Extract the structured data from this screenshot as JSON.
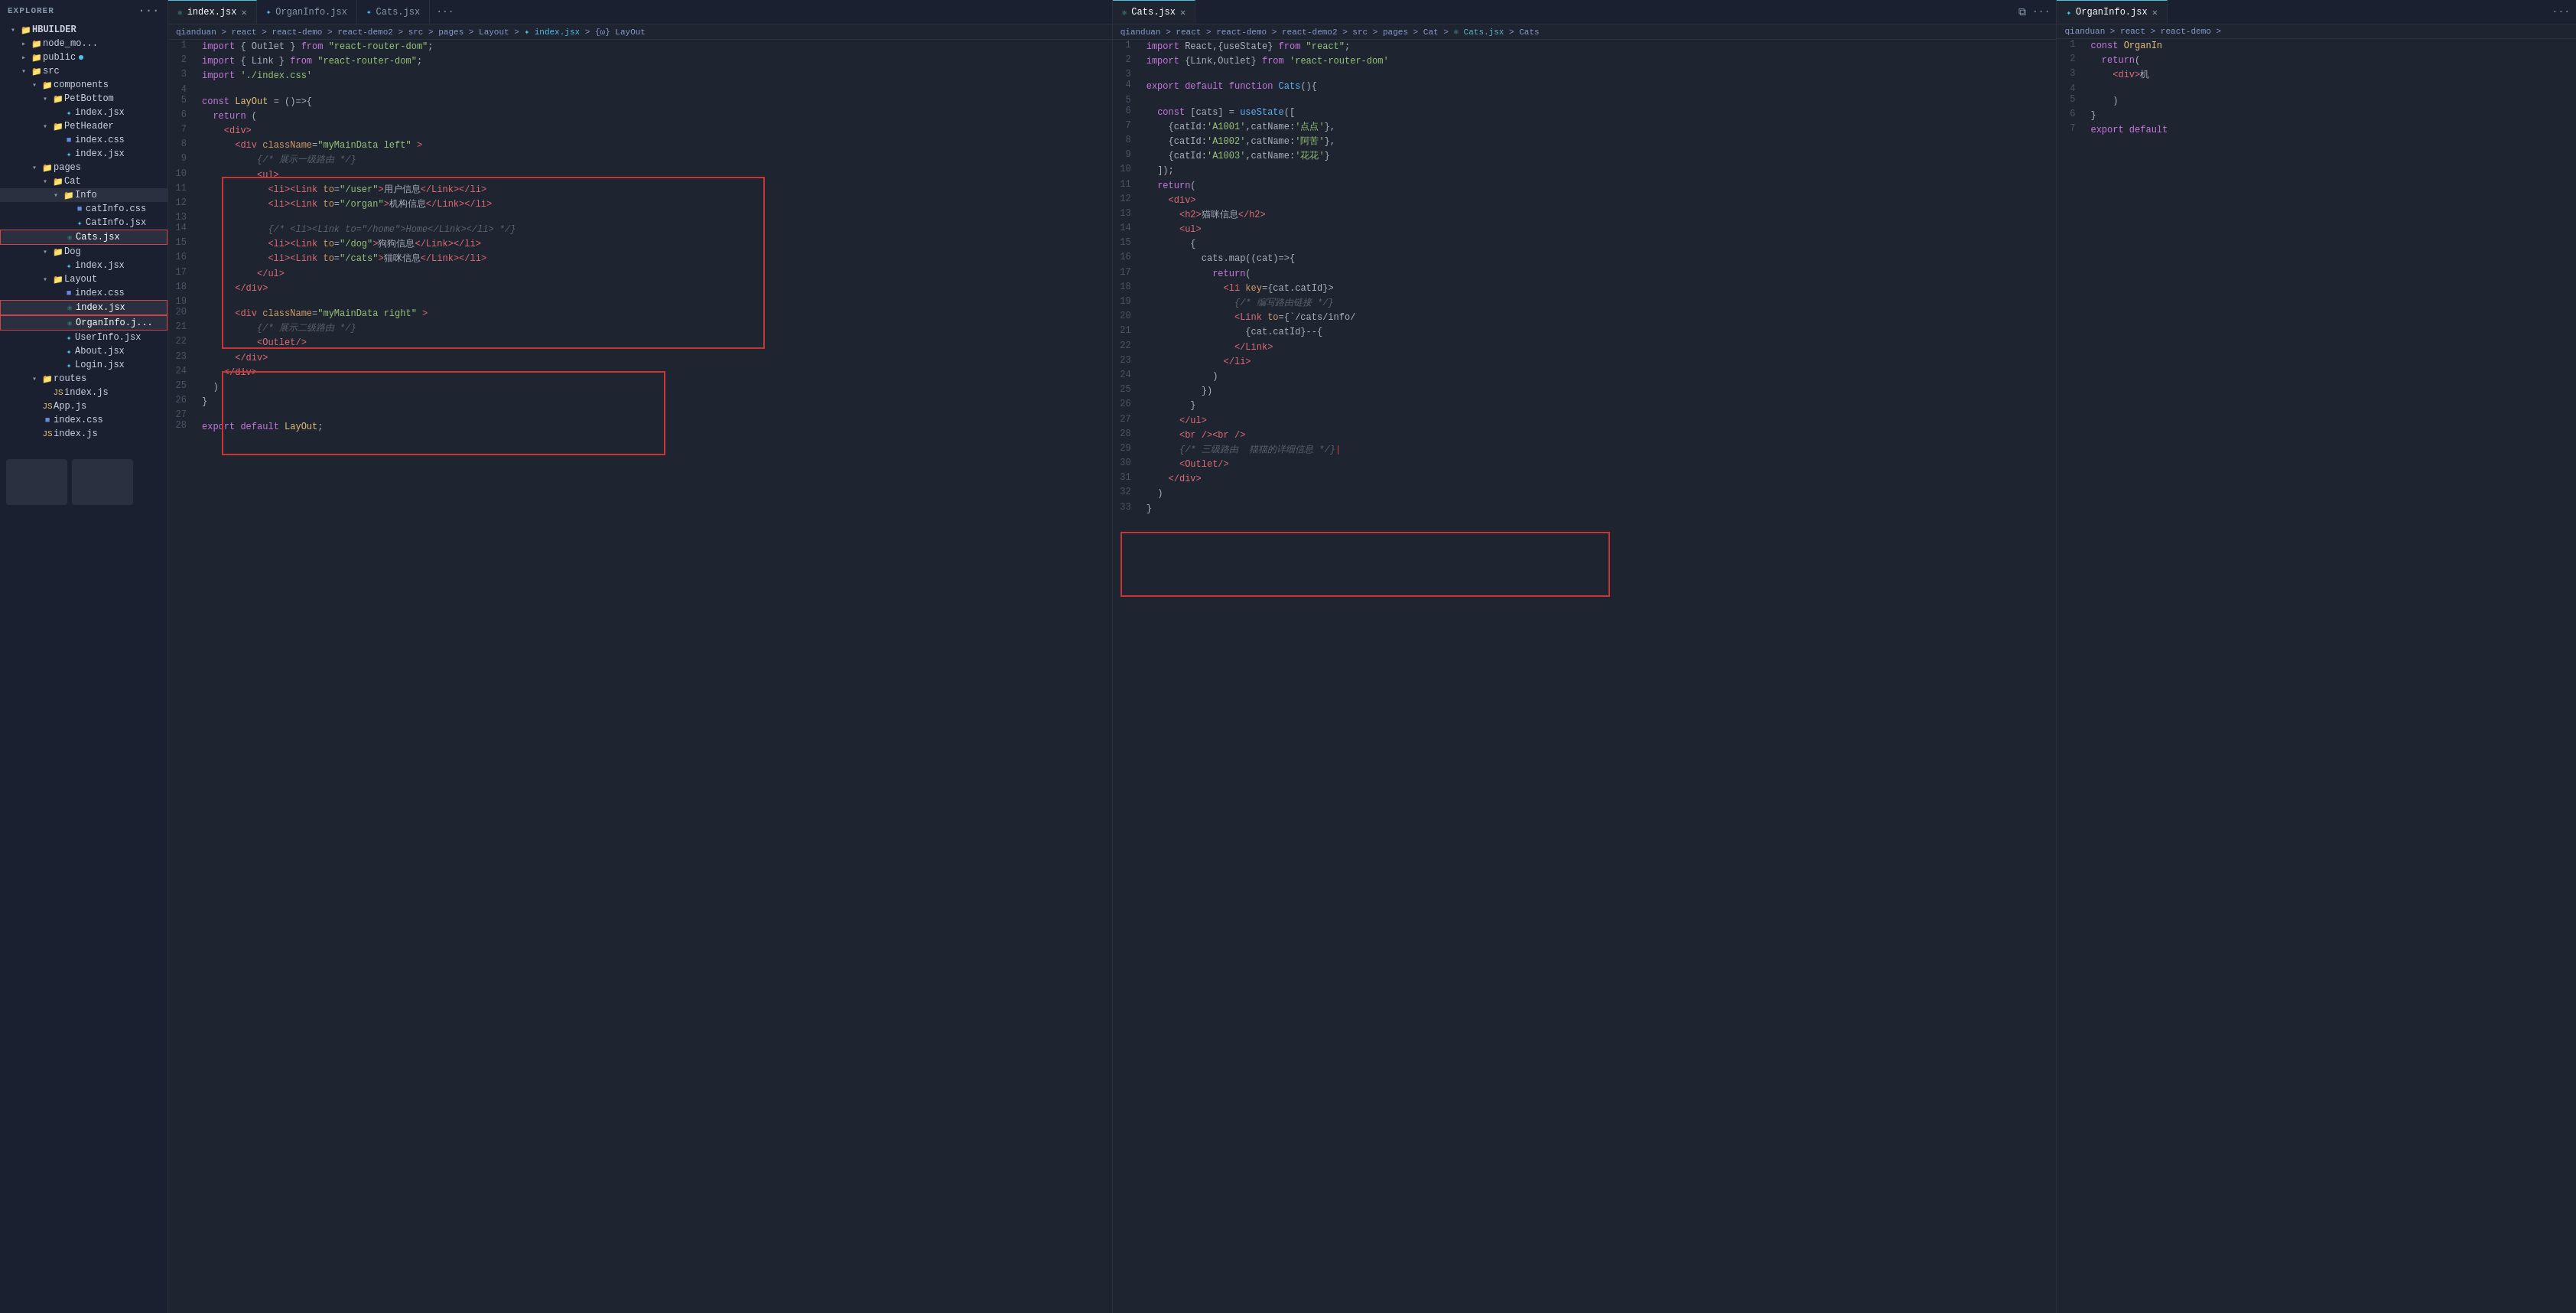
{
  "sidebar": {
    "title": "EXPLORER",
    "root": "HBUILDER",
    "items": [
      {
        "id": "node_mo",
        "label": "node_mo...",
        "type": "folder",
        "depth": 1,
        "expanded": false
      },
      {
        "id": "public",
        "label": "public",
        "type": "folder",
        "depth": 1,
        "expanded": false,
        "dot": "blue"
      },
      {
        "id": "src",
        "label": "src",
        "type": "folder",
        "depth": 1,
        "expanded": true
      },
      {
        "id": "components",
        "label": "components",
        "type": "folder",
        "depth": 2,
        "expanded": true
      },
      {
        "id": "PetBottom",
        "label": "PetBottom",
        "type": "folder",
        "depth": 3,
        "expanded": true
      },
      {
        "id": "pet_index_jsx",
        "label": "index.jsx",
        "type": "jsx",
        "depth": 4
      },
      {
        "id": "PetHeader",
        "label": "PetHeader",
        "type": "folder",
        "depth": 3,
        "expanded": true
      },
      {
        "id": "petheader_css",
        "label": "index.css",
        "type": "css",
        "depth": 4
      },
      {
        "id": "petheader_jsx",
        "label": "index.jsx",
        "type": "jsx",
        "depth": 4
      },
      {
        "id": "pages",
        "label": "pages",
        "type": "folder",
        "depth": 2,
        "expanded": true
      },
      {
        "id": "Cat",
        "label": "Cat",
        "type": "folder",
        "depth": 3,
        "expanded": true
      },
      {
        "id": "Info",
        "label": "Info",
        "type": "folder",
        "depth": 4,
        "expanded": true
      },
      {
        "id": "catinfo_css",
        "label": "catInfo.css",
        "type": "css",
        "depth": 5
      },
      {
        "id": "CatInfo_jsx",
        "label": "CatInfo.jsx",
        "type": "jsx",
        "depth": 5
      },
      {
        "id": "Cats_jsx",
        "label": "Cats.jsx",
        "type": "jsx-react",
        "depth": 4,
        "selected": true
      },
      {
        "id": "Dog",
        "label": "Dog",
        "type": "folder",
        "depth": 3,
        "expanded": true
      },
      {
        "id": "dog_index_jsx",
        "label": "index.jsx",
        "type": "jsx",
        "depth": 4
      },
      {
        "id": "Layout",
        "label": "Layout",
        "type": "folder",
        "depth": 3,
        "expanded": true
      },
      {
        "id": "layout_css",
        "label": "index.css",
        "type": "css",
        "depth": 4
      },
      {
        "id": "layout_index_jsx",
        "label": "index.jsx",
        "type": "jsx-react",
        "depth": 4,
        "selected2": true
      },
      {
        "id": "OrganInfo_jsx",
        "label": "OrganInfo.j...",
        "type": "jsx-react",
        "depth": 4,
        "selected3": true
      },
      {
        "id": "UserInfo_jsx",
        "label": "UserInfo.jsx",
        "type": "jsx",
        "depth": 4
      },
      {
        "id": "About_jsx",
        "label": "About.jsx",
        "type": "jsx",
        "depth": 4
      },
      {
        "id": "Login_jsx",
        "label": "Login.jsx",
        "type": "jsx",
        "depth": 4
      },
      {
        "id": "routes",
        "label": "routes",
        "type": "folder",
        "depth": 2,
        "expanded": true
      },
      {
        "id": "routes_index",
        "label": "index.js",
        "type": "js",
        "depth": 3
      },
      {
        "id": "App_js",
        "label": "App.js",
        "type": "js",
        "depth": 2
      },
      {
        "id": "index_css",
        "label": "index.css",
        "type": "css",
        "depth": 2
      },
      {
        "id": "index_js",
        "label": "index.js",
        "type": "js",
        "depth": 2
      }
    ]
  },
  "tabs": {
    "panel1": [
      {
        "label": "index.jsx",
        "icon": "jsx-react",
        "active": true,
        "closable": true
      },
      {
        "label": "OrganInfo.jsx",
        "icon": "jsx",
        "active": false,
        "closable": false
      },
      {
        "label": "Cats.jsx",
        "icon": "jsx",
        "active": false,
        "closable": false
      }
    ],
    "panel2": [
      {
        "label": "Cats.jsx",
        "icon": "jsx-react",
        "active": true,
        "closable": true
      }
    ],
    "panel3": [
      {
        "label": "OrganInfo.jsx",
        "icon": "jsx",
        "active": true,
        "closable": true
      }
    ]
  },
  "breadcrumbs": {
    "panel1": "qianduan > react > react-demo > react-demo2 > src > pages > Layout > ✦ index.jsx > {ω} LayOut",
    "panel2": "qianduan > react > react-demo > react-demo2 > src > pages > Cat > ✦ Cats.jsx > Cats",
    "panel3": "qianduan > react > react-demo >"
  },
  "code": {
    "panel1": [
      {
        "n": 1,
        "t": "import { Outlet } from \"react-router-dom\";"
      },
      {
        "n": 2,
        "t": "import { Link } from \"react-router-dom\";"
      },
      {
        "n": 3,
        "t": "import './index.css'"
      },
      {
        "n": 4,
        "t": ""
      },
      {
        "n": 5,
        "t": "const LayOut = ()=>{"
      },
      {
        "n": 6,
        "t": "  return ("
      },
      {
        "n": 7,
        "t": "    <div>"
      },
      {
        "n": 8,
        "t": "      <div className=\"myMainData left\" >"
      },
      {
        "n": 9,
        "t": "          {/* 展示一级路由 */}"
      },
      {
        "n": 10,
        "t": "          <ul>"
      },
      {
        "n": 11,
        "t": "            <li><Link to=\"/user\">用户信息</Link></li>"
      },
      {
        "n": 12,
        "t": "            <li><Link to=\"/organ\">机构信息</Link></li>"
      },
      {
        "n": 13,
        "t": ""
      },
      {
        "n": 14,
        "t": "            {/* <li><Link to=\"/home\">Home</Link></li> */}"
      },
      {
        "n": 15,
        "t": "            <li><Link to=\"/dog\">狗狗信息</Link></li>"
      },
      {
        "n": 16,
        "t": "            <li><Link to=\"/cats\">猫咪信息</Link></li>"
      },
      {
        "n": 17,
        "t": "          </ul>"
      },
      {
        "n": 18,
        "t": "      </div>"
      },
      {
        "n": 19,
        "t": ""
      },
      {
        "n": 20,
        "t": "      <div className=\"myMainData right\" >"
      },
      {
        "n": 21,
        "t": "          {/* 展示二级路由 */}"
      },
      {
        "n": 22,
        "t": "          <Outlet/>"
      },
      {
        "n": 23,
        "t": "      </div>"
      },
      {
        "n": 24,
        "t": "    </div>"
      },
      {
        "n": 25,
        "t": "  )"
      },
      {
        "n": 26,
        "t": "}"
      },
      {
        "n": 27,
        "t": ""
      },
      {
        "n": 28,
        "t": "export default LayOut;"
      }
    ],
    "panel2": [
      {
        "n": 1,
        "t": "import React,{useState} from \"react\";"
      },
      {
        "n": 2,
        "t": "import {Link,Outlet} from 'react-router-dom'"
      },
      {
        "n": 3,
        "t": ""
      },
      {
        "n": 4,
        "t": "export default function Cats(){"
      },
      {
        "n": 5,
        "t": ""
      },
      {
        "n": 6,
        "t": "  const [cats] = useState(["
      },
      {
        "n": 7,
        "t": "    {catId:'A1001',catName:'点点'},"
      },
      {
        "n": 8,
        "t": "    {catId:'A1002',catName:'阿苦'},"
      },
      {
        "n": 9,
        "t": "    {catId:'A1003',catName:'花花'}"
      },
      {
        "n": 10,
        "t": "  ]);"
      },
      {
        "n": 11,
        "t": "  return("
      },
      {
        "n": 12,
        "t": "    <div>"
      },
      {
        "n": 13,
        "t": "      <h2>猫咪信息</h2>"
      },
      {
        "n": 14,
        "t": "      <ul>"
      },
      {
        "n": 15,
        "t": "        {"
      },
      {
        "n": 16,
        "t": "          cats.map((cat)=>{"
      },
      {
        "n": 17,
        "t": "            return("
      },
      {
        "n": 18,
        "t": "              <li key={cat.catId}>"
      },
      {
        "n": 19,
        "t": "                {/* 编写路由链接 */}"
      },
      {
        "n": 20,
        "t": "                <Link to={`/cats/info/"
      },
      {
        "n": 21,
        "t": "                  {cat.catId}--{"
      },
      {
        "n": 22,
        "t": "                </Link>"
      },
      {
        "n": 23,
        "t": "              </li>"
      },
      {
        "n": 24,
        "t": "            )"
      },
      {
        "n": 25,
        "t": "          })"
      },
      {
        "n": 26,
        "t": "        }"
      },
      {
        "n": 27,
        "t": "      </ul>"
      },
      {
        "n": 28,
        "t": "      <br /><br />"
      },
      {
        "n": 29,
        "t": "      {/* 三级路由  猫猫的详细信息 */}"
      },
      {
        "n": 30,
        "t": "      <Outlet/>"
      },
      {
        "n": 31,
        "t": "    </div>"
      },
      {
        "n": 32,
        "t": "  )"
      },
      {
        "n": 33,
        "t": "}"
      }
    ],
    "panel3": [
      {
        "n": 1,
        "t": "const OrganIn"
      },
      {
        "n": 2,
        "t": "  return("
      },
      {
        "n": 3,
        "t": "    <div>机"
      },
      {
        "n": 4,
        "t": ""
      },
      {
        "n": 5,
        "t": "    )"
      },
      {
        "n": 6,
        "t": "}"
      },
      {
        "n": 7,
        "t": "export default"
      }
    ]
  }
}
